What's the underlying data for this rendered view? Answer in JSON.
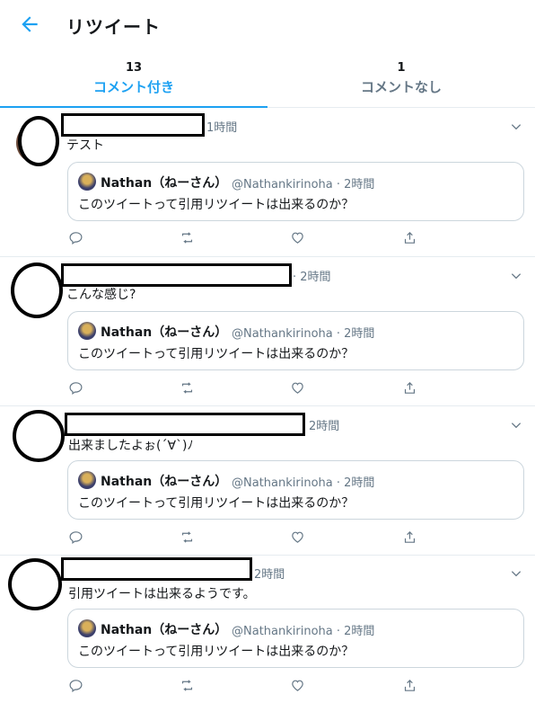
{
  "header": {
    "title": "リツイート",
    "back_icon": "arrow-left-icon"
  },
  "tabs": [
    {
      "count": "13",
      "label": "コメント付き",
      "active": true
    },
    {
      "count": "1",
      "label": "コメントなし",
      "active": false
    }
  ],
  "accent_color": "#1da1f2",
  "quoted": {
    "name": "Nathan（ねーさん）",
    "handle": "@Nathankirinoha · 2時間",
    "text": "このツイートって引用リツイートは出来るのか？"
  },
  "tweets": [
    {
      "time": "1時間",
      "text": "テスト"
    },
    {
      "time": "· 2時間",
      "text": "こんな感じ?"
    },
    {
      "time": "2時間",
      "text": "出来ましたよぉ(´∀`)ﾉ"
    },
    {
      "time": "2時間",
      "text": "引用ツイートは出来るようです。"
    }
  ]
}
